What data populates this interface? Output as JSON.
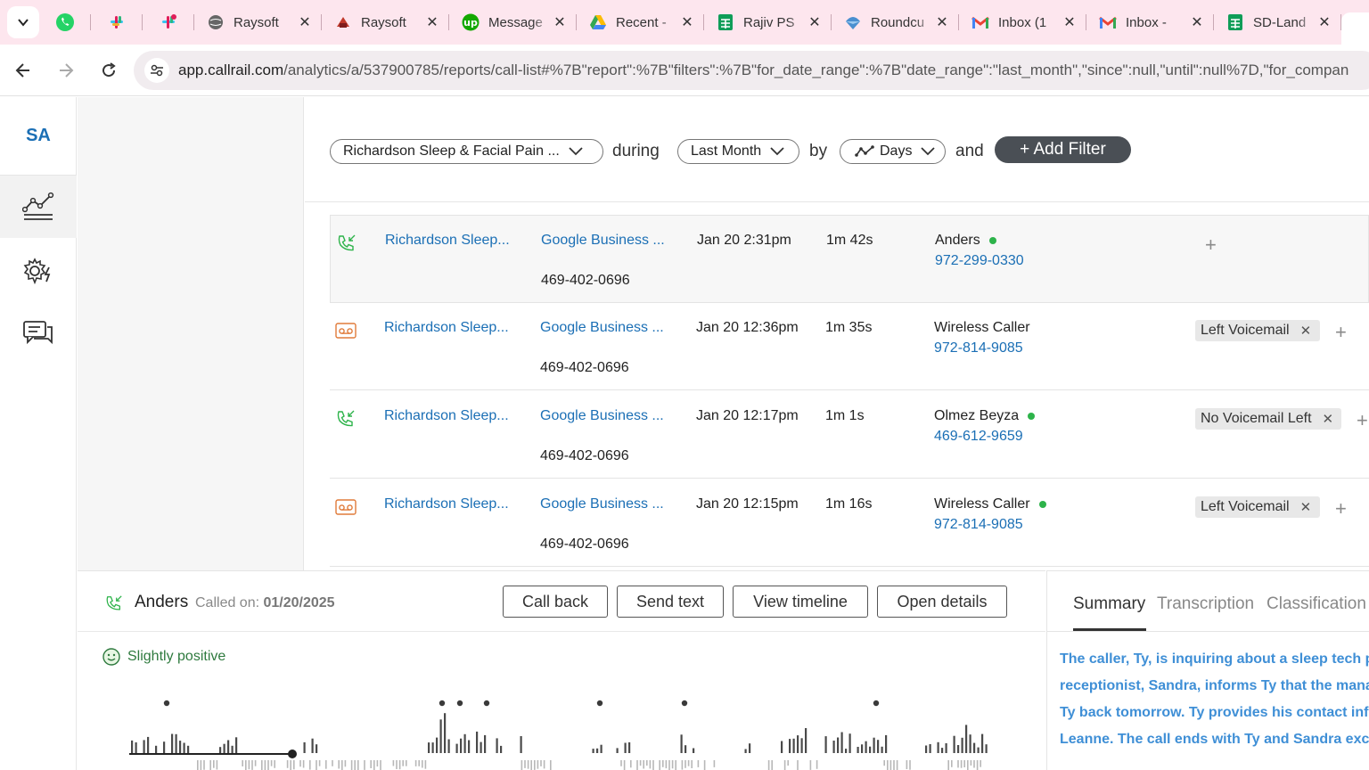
{
  "browser": {
    "tabs": [
      {
        "title": "Raysoft",
        "favicon": "globe-icon"
      },
      {
        "title": "Raysoft",
        "favicon": "raysoft-logo-icon"
      },
      {
        "title": "Message",
        "favicon": "upwork-icon"
      },
      {
        "title": "Recent -",
        "favicon": "google-drive-icon"
      },
      {
        "title": "Rajiv PS",
        "favicon": "google-sheets-icon"
      },
      {
        "title": "Roundcu",
        "favicon": "roundcube-icon"
      },
      {
        "title": "Inbox (1",
        "favicon": "gmail-icon"
      },
      {
        "title": "Inbox - ",
        "favicon": "gmail-icon"
      },
      {
        "title": "SD-Land",
        "favicon": "google-sheets-icon"
      }
    ],
    "url_host": "app.callrail.com",
    "url_path": "/analytics/a/537900785/reports/call-list#%7B\"report\":%7B\"filters\":%7B\"for_date_range\":%7B\"date_range\":\"last_month\",\"since\":null,\"until\":null%7D,\"for_compan"
  },
  "rail": {
    "account_initials": "SA",
    "items": [
      "analytics-icon",
      "settings-automation-icon",
      "messages-icon"
    ]
  },
  "filters": {
    "company": "Richardson Sleep & Facial Pain ...",
    "during_word": "during",
    "date_range": "Last Month",
    "by_word": "by",
    "interval": "Days",
    "and_word": "and",
    "add_filter": "+ Add Filter"
  },
  "calls": [
    {
      "type": "answered",
      "company": "Richardson Sleep...",
      "source": "Google Business ...",
      "tracking_number": "469-402-0696",
      "date": "Jan 20 2:31pm",
      "duration": "1m 42s",
      "caller": "Anders",
      "caller_dot": true,
      "caller_number": "972-299-0330",
      "tag": ""
    },
    {
      "type": "voicemail",
      "company": "Richardson Sleep...",
      "source": "Google Business ...",
      "tracking_number": "469-402-0696",
      "date": "Jan 20 12:36pm",
      "duration": "1m 35s",
      "caller": "Wireless Caller",
      "caller_dot": false,
      "caller_number": "972-814-9085",
      "tag": "Left Voicemail"
    },
    {
      "type": "answered",
      "company": "Richardson Sleep...",
      "source": "Google Business ...",
      "tracking_number": "469-402-0696",
      "date": "Jan 20 12:17pm",
      "duration": "1m 1s",
      "caller": "Olmez Beyza",
      "caller_dot": true,
      "caller_number": "469-612-9659",
      "tag": "No Voicemail Left"
    },
    {
      "type": "voicemail",
      "company": "Richardson Sleep...",
      "source": "Google Business ...",
      "tracking_number": "469-402-0696",
      "date": "Jan 20 12:15pm",
      "duration": "1m 16s",
      "caller": "Wireless Caller",
      "caller_dot": true,
      "caller_number": "972-814-9085",
      "tag": "Left Voicemail"
    }
  ],
  "detail": {
    "name": "Anders",
    "called_on_label": "Called on:",
    "called_on": "01/20/2025",
    "buttons": [
      "Call back",
      "Send text",
      "View timeline",
      "Open details"
    ],
    "sentiment": "Slightly positive"
  },
  "summary": {
    "tabs": [
      "Summary",
      "Transcription",
      "Classification"
    ],
    "lines": [
      "The caller, Ty, is inquiring about a sleep tech po",
      "receptionist, Sandra, informs Ty that the mana",
      "Ty back tomorrow. Ty provides his contact info",
      "Leanne. The call ends with Ty and Sandra exch"
    ]
  },
  "colors": {
    "link": "#1b6fb5",
    "answered_icon": "#2db34a",
    "voicemail_icon": "#e07b3a",
    "summary_text": "#3f8fd6"
  }
}
